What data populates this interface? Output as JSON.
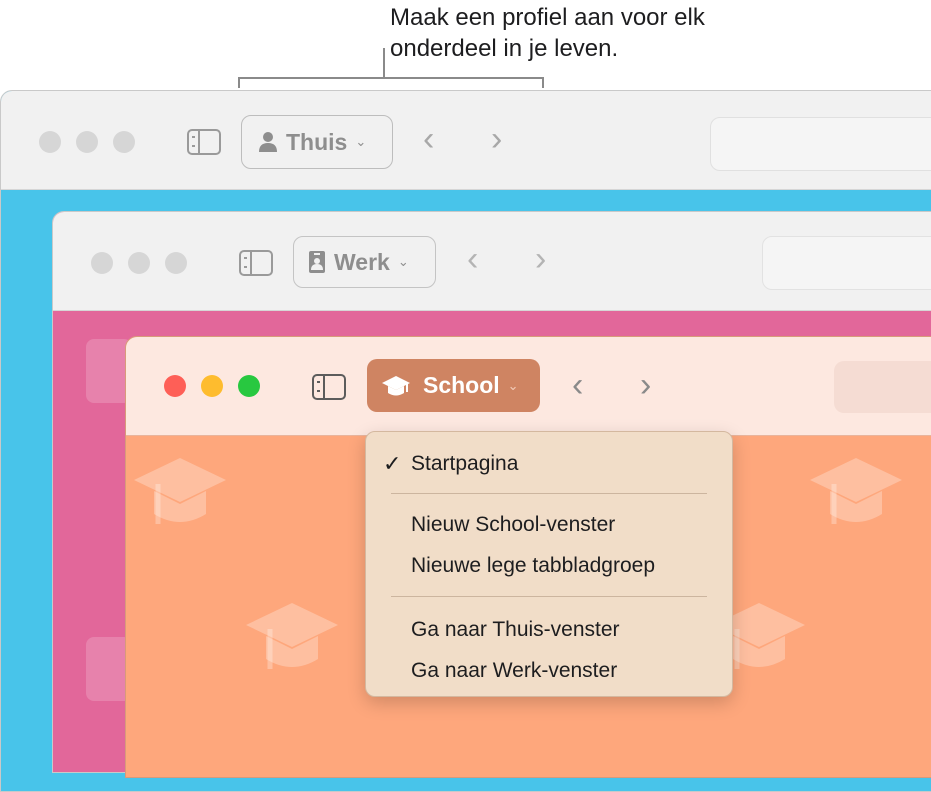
{
  "callout": {
    "line1": "Maak een profiel aan voor elk",
    "line2": "onderdeel in je leven."
  },
  "windows": {
    "thuis": {
      "profile_label": "Thuis",
      "profile_icon": "person-icon"
    },
    "werk": {
      "profile_label": "Werk",
      "profile_icon": "id-badge-icon"
    },
    "school": {
      "profile_label": "School",
      "profile_icon": "graduation-cap-icon"
    }
  },
  "traffic_light_colors": {
    "close": "#fe5f57",
    "minimize": "#febc2e",
    "zoom": "#28c840"
  },
  "profile_colors": {
    "thuis": "#48c4ea",
    "werk": "#e2679a",
    "school": "#fea77c"
  },
  "nav": {
    "back": "‹",
    "forward": "›"
  },
  "menu": {
    "items": [
      {
        "label": "Startpagina",
        "checked": true
      },
      {
        "label": "Nieuw School-venster"
      },
      {
        "label": "Nieuwe lege tabbladgroep"
      },
      {
        "label": "Ga naar Thuis-venster"
      },
      {
        "label": "Ga naar Werk-venster"
      }
    ],
    "check_mark": "✓"
  }
}
